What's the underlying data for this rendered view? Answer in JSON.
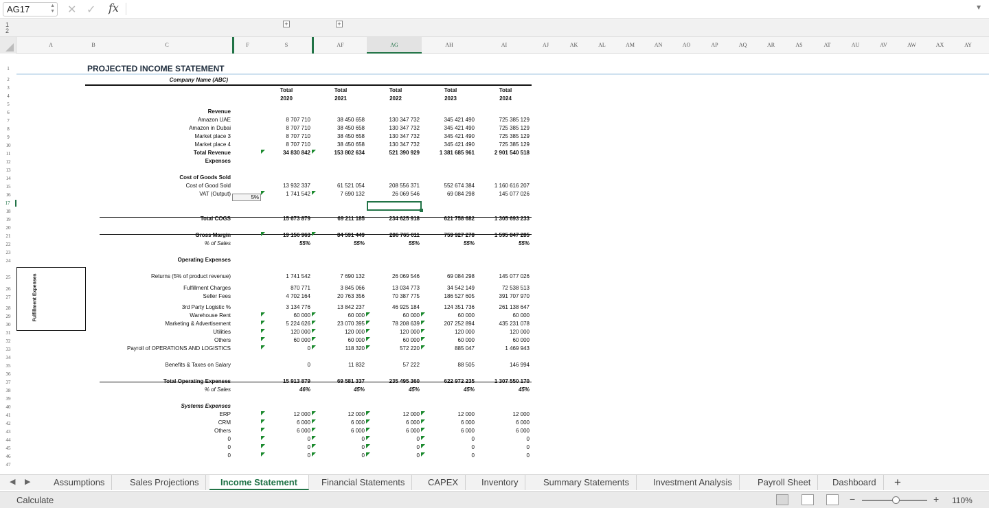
{
  "formula_bar": {
    "name_box": "AG17",
    "fx_label": "fx",
    "formula": ""
  },
  "outline_levels": [
    "1",
    "2"
  ],
  "columns": [
    "A",
    "B",
    "C",
    "F",
    "S",
    "AF",
    "AG",
    "AH",
    "AI",
    "AJ",
    "AK",
    "AL",
    "AM",
    "AN",
    "AO",
    "AP",
    "AQ",
    "AR",
    "AS",
    "AT",
    "AU",
    "AV",
    "AW",
    "AX",
    "AY"
  ],
  "selected_column": "AG",
  "row_numbers": [
    "1",
    "2",
    "3",
    "4",
    "5",
    "6",
    "7",
    "8",
    "9",
    "10",
    "11",
    "12",
    "13",
    "14",
    "15",
    "16",
    "17",
    "18",
    "19",
    "20",
    "21",
    "22",
    "23",
    "24",
    "25",
    "26",
    "27",
    "28",
    "29",
    "30",
    "31",
    "32",
    "33",
    "34",
    "35",
    "36",
    "37",
    "38",
    "39",
    "40",
    "41",
    "42",
    "43",
    "44",
    "45",
    "46",
    "47"
  ],
  "selected_row": "17",
  "sheet": {
    "title": "PROJECTED  INCOME STATEMENT",
    "company": "Company Name (ABC)",
    "side_label": "Fulfillment Expenses",
    "header_total": "Total",
    "years": [
      "2020",
      "2021",
      "2022",
      "2023",
      "2024"
    ],
    "vat_rate": "5%",
    "rows": [
      {
        "row": 6,
        "label": "Revenue",
        "style": "b",
        "values": []
      },
      {
        "row": 7,
        "label": "Amazon UAE",
        "values": [
          "8 707 710",
          "38 450 658",
          "130 347 732",
          "345 421 490",
          "725 385 129"
        ]
      },
      {
        "row": 8,
        "label": "Amazon in Dubai",
        "values": [
          "8 707 710",
          "38 450 658",
          "130 347 732",
          "345 421 490",
          "725 385 129"
        ]
      },
      {
        "row": 9,
        "label": "Market place 3",
        "values": [
          "8 707 710",
          "38 450 658",
          "130 347 732",
          "345 421 490",
          "725 385 129"
        ]
      },
      {
        "row": 10,
        "label": "Market place 4",
        "values": [
          "8 707 710",
          "38 450 658",
          "130 347 732",
          "345 421 490",
          "725 385 129"
        ]
      },
      {
        "row": 11,
        "label": "Total Revenue",
        "style": "b",
        "values": [
          "34 830 842",
          "153 802 634",
          "521 390 929",
          "1 381 685 961",
          "2 901 540 518"
        ]
      },
      {
        "row": 14,
        "label": "Expenses",
        "style": "b",
        "values": []
      },
      {
        "row": 15,
        "label": "Cost of Goods Sold",
        "style": "b",
        "values": []
      },
      {
        "row": 16,
        "label": "Cost of Good Sold",
        "values": [
          "13 932 337",
          "61 521 054",
          "208 556 371",
          "552 674 384",
          "1 160 616 207"
        ]
      },
      {
        "row": 17,
        "label": "VAT (Output)",
        "values": [
          "1 741 542",
          "7 690 132",
          "26 069 546",
          "69 084 298",
          "145 077 026"
        ]
      },
      {
        "row": 20,
        "label": "Total COGS",
        "style": "b",
        "values": [
          "15 673 879",
          "69 211 185",
          "234 625 918",
          "621 758 682",
          "1 305 693 233"
        ]
      },
      {
        "row": 22,
        "label": "Gross Margin",
        "style": "b",
        "values": [
          "19 156 963",
          "84 591 449",
          "286 765 011",
          "759 927 278",
          "1 595 847 285"
        ]
      },
      {
        "row": 23,
        "label": "% of Sales",
        "style": "i",
        "values": [
          "55%",
          "55%",
          "55%",
          "55%",
          "55%"
        ]
      },
      {
        "row": 25,
        "label": "Operating Expenses",
        "style": "b",
        "values": []
      },
      {
        "row": 27,
        "label": "Returns (5% of product revenue)",
        "values": [
          "1 741 542",
          "7 690 132",
          "26 069 546",
          "69 084 298",
          "145 077 026"
        ]
      },
      {
        "row": 28,
        "label": "Fulfillment Charges",
        "values": [
          "870 771",
          "3 845 066",
          "13 034 773",
          "34 542 149",
          "72 538 513"
        ]
      },
      {
        "row": 29,
        "label": "Seller Fees",
        "values": [
          "4 702 164",
          "20 763 356",
          "70 387 775",
          "186 527 605",
          "391 707 970"
        ]
      },
      {
        "row": 30,
        "label": "3rd Party Logistic %",
        "values": [
          "3 134 776",
          "13 842 237",
          "46 925 184",
          "124 351 736",
          "261 138 647"
        ]
      },
      {
        "row": 31,
        "label": "Warehouse Rent",
        "values": [
          "60 000",
          "60 000",
          "60 000",
          "60 000",
          "60 000"
        ]
      },
      {
        "row": 32,
        "label": "Marketing  & Advertisement",
        "values": [
          "5 224 626",
          "23 070 395",
          "78 208 639",
          "207 252 894",
          "435 231 078"
        ]
      },
      {
        "row": 33,
        "label": "Utilities",
        "values": [
          "120 000",
          "120 000",
          "120 000",
          "120 000",
          "120 000"
        ]
      },
      {
        "row": 34,
        "label": "Others",
        "values": [
          "60 000",
          "60 000",
          "60 000",
          "60 000",
          "60 000"
        ]
      },
      {
        "row": 35,
        "label": "Payroll of OPERATIONS AND LOGISTICS",
        "values": [
          "0",
          "118 320",
          "572 220",
          "885 047",
          "1 469 943"
        ]
      },
      {
        "row": 37,
        "label": "Benefits & Taxes on Salary",
        "values": [
          "0",
          "11 832",
          "57 222",
          "88 505",
          "146 994"
        ]
      },
      {
        "row": 39,
        "label": "Total Operating Expenses",
        "style": "b",
        "values": [
          "15 913 879",
          "69 581 337",
          "235 495 360",
          "622 972 235",
          "1 307 550 170"
        ]
      },
      {
        "row": 40,
        "label": "% of Sales",
        "style": "i",
        "values": [
          "46%",
          "45%",
          "45%",
          "45%",
          "45%"
        ]
      },
      {
        "row": 42,
        "label": "Systems Expenses",
        "style": "bi",
        "values": []
      },
      {
        "row": 43,
        "label": "ERP",
        "values": [
          "12 000",
          "12 000",
          "12 000",
          "12 000",
          "12 000"
        ]
      },
      {
        "row": 44,
        "label": "CRM",
        "values": [
          "6 000",
          "6 000",
          "6 000",
          "6 000",
          "6 000"
        ]
      },
      {
        "row": 45,
        "label": "Others",
        "values": [
          "6 000",
          "6 000",
          "6 000",
          "6 000",
          "6 000"
        ]
      },
      {
        "row": 46,
        "label": "0",
        "values": [
          "0",
          "0",
          "0",
          "0",
          "0"
        ]
      },
      {
        "row": 47,
        "label": "0",
        "values": [
          "0",
          "0",
          "0",
          "0",
          "0"
        ]
      },
      {
        "row": 48,
        "label": "0",
        "values": [
          "0",
          "0",
          "0",
          "0",
          "0"
        ]
      }
    ]
  },
  "tabs": [
    "Assumptions",
    "Sales Projections",
    "Income Statement",
    "Financial Statements",
    "CAPEX",
    "Inventory",
    "Summary Statements",
    "Investment Analysis",
    "Payroll Sheet",
    "Dashboard"
  ],
  "active_tab": "Income Statement",
  "add_sheet_label": "+",
  "status": {
    "mode": "Calculate",
    "zoom": "110%",
    "zoom_minus": "−",
    "zoom_plus": "+"
  },
  "colors": {
    "accent": "#217346",
    "error_triangle": "#1b8a2e"
  }
}
